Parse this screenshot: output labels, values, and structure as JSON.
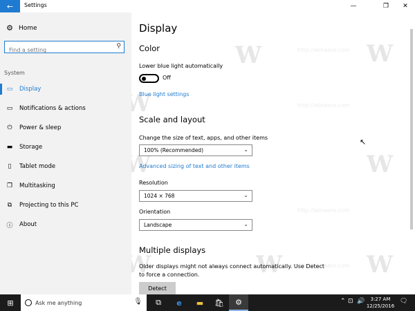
{
  "window": {
    "title": "Settings",
    "back_icon": "back-arrow-icon",
    "minimize": "—",
    "maximize": "❐",
    "close": "✕"
  },
  "sidebar": {
    "home_label": "Home",
    "search_placeholder": "Find a setting",
    "section": "System",
    "items": [
      {
        "label": "Display",
        "icon": "monitor-icon",
        "active": true
      },
      {
        "label": "Notifications & actions",
        "icon": "notification-icon"
      },
      {
        "label": "Power & sleep",
        "icon": "power-icon"
      },
      {
        "label": "Storage",
        "icon": "storage-icon"
      },
      {
        "label": "Tablet mode",
        "icon": "tablet-icon"
      },
      {
        "label": "Multitasking",
        "icon": "multitasking-icon"
      },
      {
        "label": "Projecting to this PC",
        "icon": "projecting-icon"
      },
      {
        "label": "About",
        "icon": "info-icon"
      }
    ]
  },
  "main": {
    "title": "Display",
    "color_heading": "Color",
    "blue_light_label": "Lower blue light automatically",
    "blue_light_state": "Off",
    "blue_light_link": "Blue light settings",
    "scale_heading": "Scale and layout",
    "scale_label": "Change the size of text, apps, and other items",
    "scale_value": "100% (Recommended)",
    "advanced_link": "Advanced sizing of text and other items",
    "resolution_label": "Resolution",
    "resolution_value": "1024 × 768",
    "orientation_label": "Orientation",
    "orientation_value": "Landscape",
    "multiple_heading": "Multiple displays",
    "multiple_desc_1": "Older displays might not always connect automatically. Use Detect",
    "multiple_desc_2": "to force a connection.",
    "detect_label": "Detect",
    "watermark": "http://winaero.com"
  },
  "taskbar": {
    "search_text": "Ask me anything",
    "time": "3:27 AM",
    "date": "12/25/2016"
  },
  "colors": {
    "accent": "#1f7ad1",
    "sidebar_bg": "#f2f2f2",
    "taskbar_bg": "#1b1b1b"
  }
}
